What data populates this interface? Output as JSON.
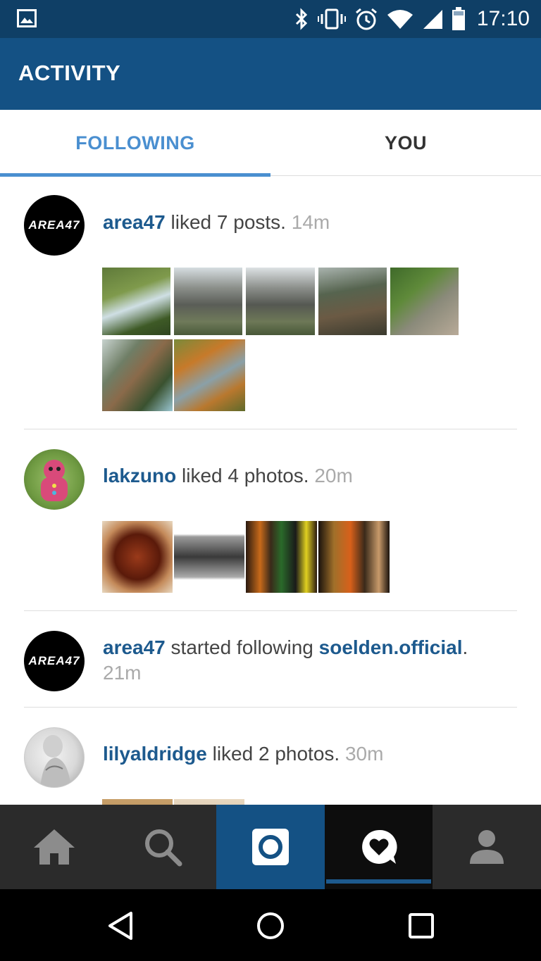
{
  "status_bar": {
    "time": "17:10",
    "icons": [
      "image-icon",
      "bluetooth-icon",
      "vibrate-icon",
      "alarm-icon",
      "wifi-icon",
      "signal-icon",
      "battery-icon"
    ]
  },
  "app_bar": {
    "title": "ACTIVITY"
  },
  "tabs": [
    {
      "label": "FOLLOWING",
      "active": true
    },
    {
      "label": "YOU",
      "active": false
    }
  ],
  "feed": [
    {
      "user": "area47",
      "action": " liked 7 posts.",
      "time": "14m",
      "avatar": "area47-logo",
      "avatar_text": "AREA47",
      "thumbnails": 7
    },
    {
      "user": "lakzuno",
      "action": " liked 4 photos.",
      "time": "20m",
      "avatar": "gingerbread-toy",
      "thumbnails": 4
    },
    {
      "user": "area47",
      "action": " started following ",
      "target": "soelden.official",
      "suffix": ".",
      "time": "21m",
      "avatar": "area47-logo",
      "avatar_text": "AREA47"
    },
    {
      "user": "lilyaldridge",
      "action": " liked 2 photos.",
      "time": "30m",
      "avatar": "portrait-photo"
    }
  ],
  "bottom_nav": {
    "items": [
      "home-icon",
      "search-icon",
      "camera-icon",
      "activity-heart-icon",
      "profile-icon"
    ],
    "active": "activity-heart-icon"
  },
  "system_nav": {
    "items": [
      "back-icon",
      "home-circle-icon",
      "recents-icon"
    ]
  },
  "colors": {
    "status_bar": "#0f3f66",
    "app_bar": "#145184",
    "tab_active": "#4a8fd0",
    "username": "#1d5a8e",
    "timestamp": "#aaaaaa"
  }
}
